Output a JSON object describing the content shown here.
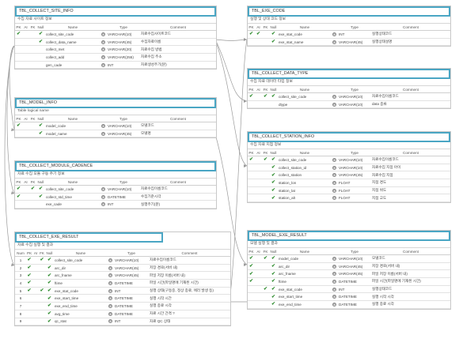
{
  "ui": {
    "check": "✔",
    "type_icon": "⊗"
  },
  "headers": {
    "pk": "PK",
    "ai": "AI",
    "fk": "FK",
    "nul": "Null",
    "name": "Name",
    "type": "Type",
    "comment": "Comment",
    "num": "Num"
  },
  "tables": [
    {
      "id": "collect-site-info",
      "title": "TBL_COLLECT_SITE_INFO",
      "desc": "수집 자료 사이트 정보",
      "rows": [
        {
          "pk": true,
          "ai": false,
          "fk": false,
          "nul": true,
          "name": "collect_site_code",
          "type": "VARCHAR(10)",
          "comment": "자료수집사이트코드"
        },
        {
          "pk": false,
          "ai": false,
          "fk": false,
          "nul": true,
          "name": "collect_data_name",
          "type": "VARCHAR(45)",
          "comment": "수집자료이름"
        },
        {
          "pk": false,
          "ai": false,
          "fk": false,
          "nul": false,
          "name": "collect_met",
          "type": "VARCHAR(20)",
          "comment": "자료수집 방법"
        },
        {
          "pk": false,
          "ai": false,
          "fk": false,
          "nul": false,
          "name": "collect_add",
          "type": "VARCHAR(255)",
          "comment": "자료수집 주소"
        },
        {
          "pk": false,
          "ai": false,
          "fk": false,
          "nul": false,
          "name": "gen_cade",
          "type": "INT",
          "comment": "자료생성주기(분)"
        }
      ]
    },
    {
      "id": "model-info",
      "title": "TBL_MODEL_INFO",
      "desc": "Table logical name",
      "rows": [
        {
          "pk": true,
          "ai": false,
          "fk": false,
          "nul": true,
          "name": "model_code",
          "type": "VARCHAR(10)",
          "comment": "모델코드"
        },
        {
          "pk": false,
          "ai": false,
          "fk": false,
          "nul": true,
          "name": "model_name",
          "type": "VARCHAR(45)",
          "comment": "모델명"
        }
      ]
    },
    {
      "id": "collect-module-cadence",
      "title": "TBL_COLLECT_MODULE_CADENCE",
      "desc": "자료 수집 모듈 구동 주기 정보",
      "rows": [
        {
          "pk": true,
          "ai": false,
          "fk": true,
          "nul": true,
          "name": "collect_site_code",
          "type": "VARCHAR(10)",
          "comment": "자료수집이름코드"
        },
        {
          "pk": true,
          "ai": false,
          "fk": false,
          "nul": true,
          "name": "collect_std_time",
          "type": "DATETIME",
          "comment": "수집기준시각"
        },
        {
          "pk": false,
          "ai": false,
          "fk": false,
          "nul": false,
          "name": "exe_cade",
          "type": "INT",
          "comment": "실행주기(분)"
        }
      ]
    },
    {
      "id": "collect-exe-result",
      "title": "TBL_COLLECT_EXE_RESULT",
      "desc": "자료 수집 실행 및 결과",
      "rows": [
        {
          "num": "1",
          "pk": true,
          "ai": false,
          "fk": true,
          "nul": true,
          "name": "collect_site_code",
          "type": "VARCHAR(10)",
          "comment": "자료수집이름코드"
        },
        {
          "num": "2",
          "pk": true,
          "ai": false,
          "fk": false,
          "nul": true,
          "name": "arc_dir",
          "type": "VARCHAR(45)",
          "comment": "저장 경로(서버 내)"
        },
        {
          "num": "3",
          "pk": true,
          "ai": false,
          "fk": false,
          "nul": true,
          "name": "arc_fname",
          "type": "VARCHAR(45)",
          "comment": "파일 저장 이름(서버 내)"
        },
        {
          "num": "4",
          "pk": true,
          "ai": false,
          "fk": false,
          "nul": true,
          "name": "ftime",
          "type": "DATETIME",
          "comment": "파일 시간(파일명에 기재된 시간)"
        },
        {
          "num": "5",
          "pk": true,
          "ai": false,
          "fk": true,
          "nul": true,
          "name": "exe_stat_code",
          "type": "INT",
          "comment": "실행 상태(구동중, 정상 종료, 에러 발생 등)"
        },
        {
          "num": "6",
          "pk": false,
          "ai": false,
          "fk": false,
          "nul": true,
          "name": "exe_start_time",
          "type": "DATETIME",
          "comment": "실행 시작 시간"
        },
        {
          "num": "7",
          "pk": false,
          "ai": false,
          "fk": false,
          "nul": true,
          "name": "exe_end_time",
          "type": "DATETIME",
          "comment": "실행 종료 시각"
        },
        {
          "num": "8",
          "pk": false,
          "ai": false,
          "fk": false,
          "nul": true,
          "name": "avg_time",
          "type": "DATETIME",
          "comment": "자료 시간 간격 ?"
        },
        {
          "num": "9",
          "pk": false,
          "ai": false,
          "fk": false,
          "nul": true,
          "name": "qc_stat",
          "type": "INT",
          "comment": "자료 QC 상태"
        }
      ]
    },
    {
      "id": "exe-code",
      "title": "TBL_EXE_CODE",
      "desc": "실행 및 상태 코드 정보",
      "rows": [
        {
          "pk": true,
          "ai": true,
          "fk": false,
          "nul": true,
          "name": "exe_stat_code",
          "type": "INT",
          "comment": "실행상태코드"
        },
        {
          "pk": false,
          "ai": false,
          "fk": false,
          "nul": true,
          "name": "exe_stat_name",
          "type": "VARCHAR(45)",
          "comment": "실행상태설명"
        }
      ]
    },
    {
      "id": "collect-data-type",
      "title": "TBL_COLLECT_DATA_TYPE",
      "desc": "수집 자료 데이터 타입 정보",
      "rows": [
        {
          "pk": true,
          "ai": false,
          "fk": true,
          "nul": true,
          "name": "collect_site_code",
          "type": "VARCHAR(10)",
          "comment": "자료수집이름코드"
        },
        {
          "pk": false,
          "ai": false,
          "fk": false,
          "nul": false,
          "name": "dtype",
          "type": "VARCHAR(10)",
          "comment": "data 종류"
        }
      ]
    },
    {
      "id": "collect-station-info",
      "title": "TBL_COLLECT_STATION_INFO",
      "desc": "수집 자료 지점 정보",
      "rows": [
        {
          "pk": true,
          "ai": false,
          "fk": true,
          "nul": true,
          "name": "collect_site_code",
          "type": "VARCHAR(10)",
          "comment": "자료수집이름코드"
        },
        {
          "pk": false,
          "ai": false,
          "fk": false,
          "nul": true,
          "name": "collect_station_id",
          "type": "VARCHAR(10)",
          "comment": "자료수집 지점 아이"
        },
        {
          "pk": false,
          "ai": false,
          "fk": false,
          "nul": true,
          "name": "collect_station",
          "type": "VARCHAR(45)",
          "comment": "자료수집 지점"
        },
        {
          "pk": false,
          "ai": false,
          "fk": false,
          "nul": true,
          "name": "station_lon",
          "type": "FLOAT",
          "comment": "지점 경도"
        },
        {
          "pk": false,
          "ai": false,
          "fk": false,
          "nul": true,
          "name": "station_lat",
          "type": "FLOAT",
          "comment": "지점 위도"
        },
        {
          "pk": false,
          "ai": false,
          "fk": false,
          "nul": true,
          "name": "station_alt",
          "type": "FLOAT",
          "comment": "지점 고도"
        }
      ]
    },
    {
      "id": "model-exe-result",
      "title": "TBL_MODEL_EXE_RESULT",
      "desc": "모델 실행 및 결과",
      "rows": [
        {
          "pk": true,
          "ai": false,
          "fk": true,
          "nul": true,
          "name": "model_code",
          "type": "VARCHAR(10)",
          "comment": "모델코드"
        },
        {
          "pk": true,
          "ai": false,
          "fk": false,
          "nul": true,
          "name": "arc_dir",
          "type": "VARCHAR(45)",
          "comment": "저장 경로(서버 내)"
        },
        {
          "pk": true,
          "ai": false,
          "fk": false,
          "nul": true,
          "name": "arc_fname",
          "type": "VARCHAR(45)",
          "comment": "파일 저장 이름(서버 내)"
        },
        {
          "pk": true,
          "ai": false,
          "fk": false,
          "nul": true,
          "name": "ftime",
          "type": "DATETIME",
          "comment": "파일 시간(파일명에 기재된 시간)"
        },
        {
          "pk": false,
          "ai": false,
          "fk": true,
          "nul": true,
          "name": "exe_stat_code",
          "type": "INT",
          "comment": "실행상태코드"
        },
        {
          "pk": false,
          "ai": false,
          "fk": false,
          "nul": true,
          "name": "exe_start_time",
          "type": "DATETIME",
          "comment": "실행 시작 시각"
        },
        {
          "pk": false,
          "ai": false,
          "fk": false,
          "nul": true,
          "name": "exe_end_time",
          "type": "DATETIME",
          "comment": "실행 종료 시각"
        }
      ]
    }
  ]
}
